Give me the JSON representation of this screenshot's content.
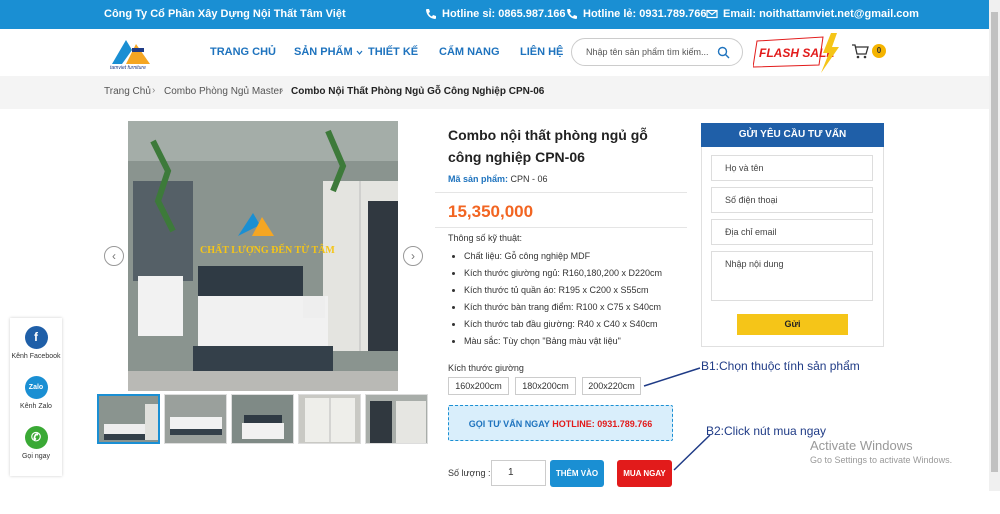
{
  "topbar": {
    "company": "Công Ty Cổ Phần Xây Dựng Nội Thất Tâm Việt",
    "hotline_si": "Hotline sỉ: 0865.987.166",
    "hotline_le": "Hotline lẻ: 0931.789.766",
    "email": "Email: noithattamviet.net@gmail.com"
  },
  "header": {
    "logo_text": "tamviet furniture",
    "nav": [
      "TRANG CHỦ",
      "SẢN PHẨM",
      "THIẾT KẾ",
      "CẨM NANG",
      "LIÊN HỆ"
    ],
    "search_placeholder": "Nhập tên sản phẩm tìm kiếm...",
    "flash_sale": "FLASH SALE",
    "cart_count": "0"
  },
  "breadcrumb": [
    "Trang Chủ",
    "Combo Phòng Ngủ Master",
    "Combo Nội Thất Phòng Ngủ Gỗ Công Nghiệp CPN-06"
  ],
  "product": {
    "title": "Combo nội thất phòng ngủ gỗ công nghiệp CPN-06",
    "sku_label": "Mã sản phẩm:",
    "sku": "CPN - 06",
    "price": "15,350,000",
    "specs_title": "Thông số kỹ thuật:",
    "specs": [
      "Chất liệu:   Gỗ công nghiệp MDF",
      "Kích thước giường ngủ:  R160,180,200 x D220cm",
      "Kích thước tủ quần áo:  R195 x C200 x S55cm",
      "Kích thước bàn trang điểm:  R100 x C75 x S40cm",
      "Kích thước tab đầu giường:  R40 x C40 x S40cm",
      "Màu sắc:  Tùy chọn \"Bảng màu vật liệu\""
    ],
    "size_label": "Kích thước giường",
    "sizes": [
      "160x200cm",
      "180x200cm",
      "200x220cm"
    ],
    "call_text": "GỌI TƯ VẤN NGAY",
    "call_hotline": "HOTLINE: 0931.789.766",
    "qty_label": "Số lượng :",
    "qty_value": "1",
    "add_to_cart": "THÊM VÀO GIỎ",
    "buy_now": "MUA NGAY",
    "image_overlay": "CHẤT LƯỢNG ĐẾN TỪ TÂM"
  },
  "consult_form": {
    "title": "GỬI YÊU CẦU TƯ VẤN",
    "fields": [
      "Họ và tên",
      "Số điện thoại",
      "Địa chỉ email",
      "Nhập nội dung"
    ],
    "submit": "Gửi"
  },
  "social": [
    "Kênh Facebook",
    "Kênh Zalo",
    "Gọi ngay"
  ],
  "social_icons": [
    "f",
    "Zalo"
  ],
  "annotations": {
    "b1": "B1:Chọn thuộc tính sản phẩm",
    "b2": "B2:Click nút mua ngay"
  },
  "windows_activation": {
    "title": "Activate Windows",
    "subtitle": "Go to Settings to activate Windows."
  }
}
